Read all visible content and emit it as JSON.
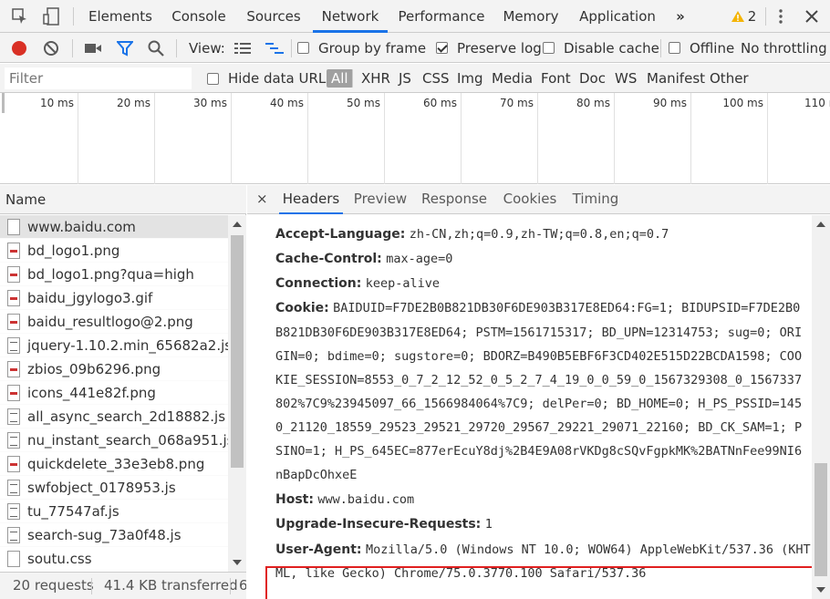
{
  "topbar": {
    "tabs": [
      "Elements",
      "Console",
      "Sources",
      "Network",
      "Performance",
      "Memory",
      "Application"
    ],
    "active_tab": "Network",
    "more": "»",
    "warning_count": "2"
  },
  "toolbar": {
    "view_label": "View:",
    "group_by_frame": "Group by frame",
    "preserve_log": "Preserve log",
    "disable_cache": "Disable cache",
    "offline": "Offline",
    "throttling": "No throttling"
  },
  "filter": {
    "placeholder": "Filter",
    "hide_data_urls": "Hide data URLs",
    "types": [
      "All",
      "XHR",
      "JS",
      "CSS",
      "Img",
      "Media",
      "Font",
      "Doc",
      "WS",
      "Manifest",
      "Other"
    ]
  },
  "timeline": {
    "ticks": [
      "10 ms",
      "20 ms",
      "30 ms",
      "40 ms",
      "50 ms",
      "60 ms",
      "70 ms",
      "80 ms",
      "90 ms",
      "100 ms",
      "110 ms"
    ]
  },
  "requests": {
    "header": "Name",
    "items": [
      {
        "name": "www.baidu.com",
        "icon": "document-icon"
      },
      {
        "name": "bd_logo1.png",
        "icon": "image-icon"
      },
      {
        "name": "bd_logo1.png?qua=high",
        "icon": "image-icon"
      },
      {
        "name": "baidu_jgylogo3.gif",
        "icon": "image-icon"
      },
      {
        "name": "baidu_resultlogo@2.png",
        "icon": "image-icon"
      },
      {
        "name": "jquery-1.10.2.min_65682a2.js",
        "icon": "script-icon"
      },
      {
        "name": "zbios_09b6296.png",
        "icon": "image-icon"
      },
      {
        "name": "icons_441e82f.png",
        "icon": "image-icon"
      },
      {
        "name": "all_async_search_2d18882.js",
        "icon": "script-icon"
      },
      {
        "name": "nu_instant_search_068a951.js",
        "icon": "script-icon"
      },
      {
        "name": "quickdelete_33e3eb8.png",
        "icon": "image-icon"
      },
      {
        "name": "swfobject_0178953.js",
        "icon": "script-icon"
      },
      {
        "name": "tu_77547af.js",
        "icon": "script-icon"
      },
      {
        "name": "search-sug_73a0f48.js",
        "icon": "script-icon"
      },
      {
        "name": "soutu.css",
        "icon": "stylesheet-icon"
      }
    ]
  },
  "status": {
    "requests": "20 requests",
    "transferred": "41.4 KB transferred",
    "trail": "6"
  },
  "details": {
    "close": "×",
    "tabs": [
      "Headers",
      "Preview",
      "Response",
      "Cookies",
      "Timing"
    ],
    "active_tab": "Headers",
    "headers": [
      {
        "name": "Accept-Language:",
        "value": "zh-CN,zh;q=0.9,zh-TW;q=0.8,en;q=0.7"
      },
      {
        "name": "Cache-Control:",
        "value": "max-age=0"
      },
      {
        "name": "Connection:",
        "value": "keep-alive"
      },
      {
        "name": "Cookie:",
        "value": "BAIDUID=F7DE2B0B821DB30F6DE903B317E8ED64:FG=1; BIDUPSID=F7DE2B0"
      },
      {
        "name": "Host:",
        "value": "www.baidu.com"
      },
      {
        "name": "Upgrade-Insecure-Requests:",
        "value": "1"
      },
      {
        "name": "User-Agent:",
        "value": "Mozilla/5.0 (Windows NT 10.0; WOW64) AppleWebKit/537.36 (KHT"
      }
    ],
    "cookie_continuation": [
      "B821DB30F6DE903B317E8ED64; PSTM=1561715317; BD_UPN=12314753; sug=0; ORI",
      "GIN=0; bdime=0; sugstore=0; BDORZ=B490B5EBF6F3CD402E515D22BCDA1598; COO",
      "KIE_SESSION=8553_0_7_2_12_52_0_5_2_7_4_19_0_0_59_0_1567329308_0_1567337",
      "802%7C9%23945097_66_1566984064%7C9; delPer=0; BD_HOME=0; H_PS_PSSID=145",
      "0_21120_18559_29523_29521_29720_29567_29221_29071_22160; BD_CK_SAM=1; P",
      "SINO=1; H_PS_645EC=877erEcuY8dj%2B4E9A08rVKDg8cSQvFgpkMK%2BATNnFee99NI6",
      "nBapDcOhxeE"
    ],
    "ua_continuation": "ML, like Gecko) Chrome/75.0.3770.100 Safari/537.36"
  }
}
